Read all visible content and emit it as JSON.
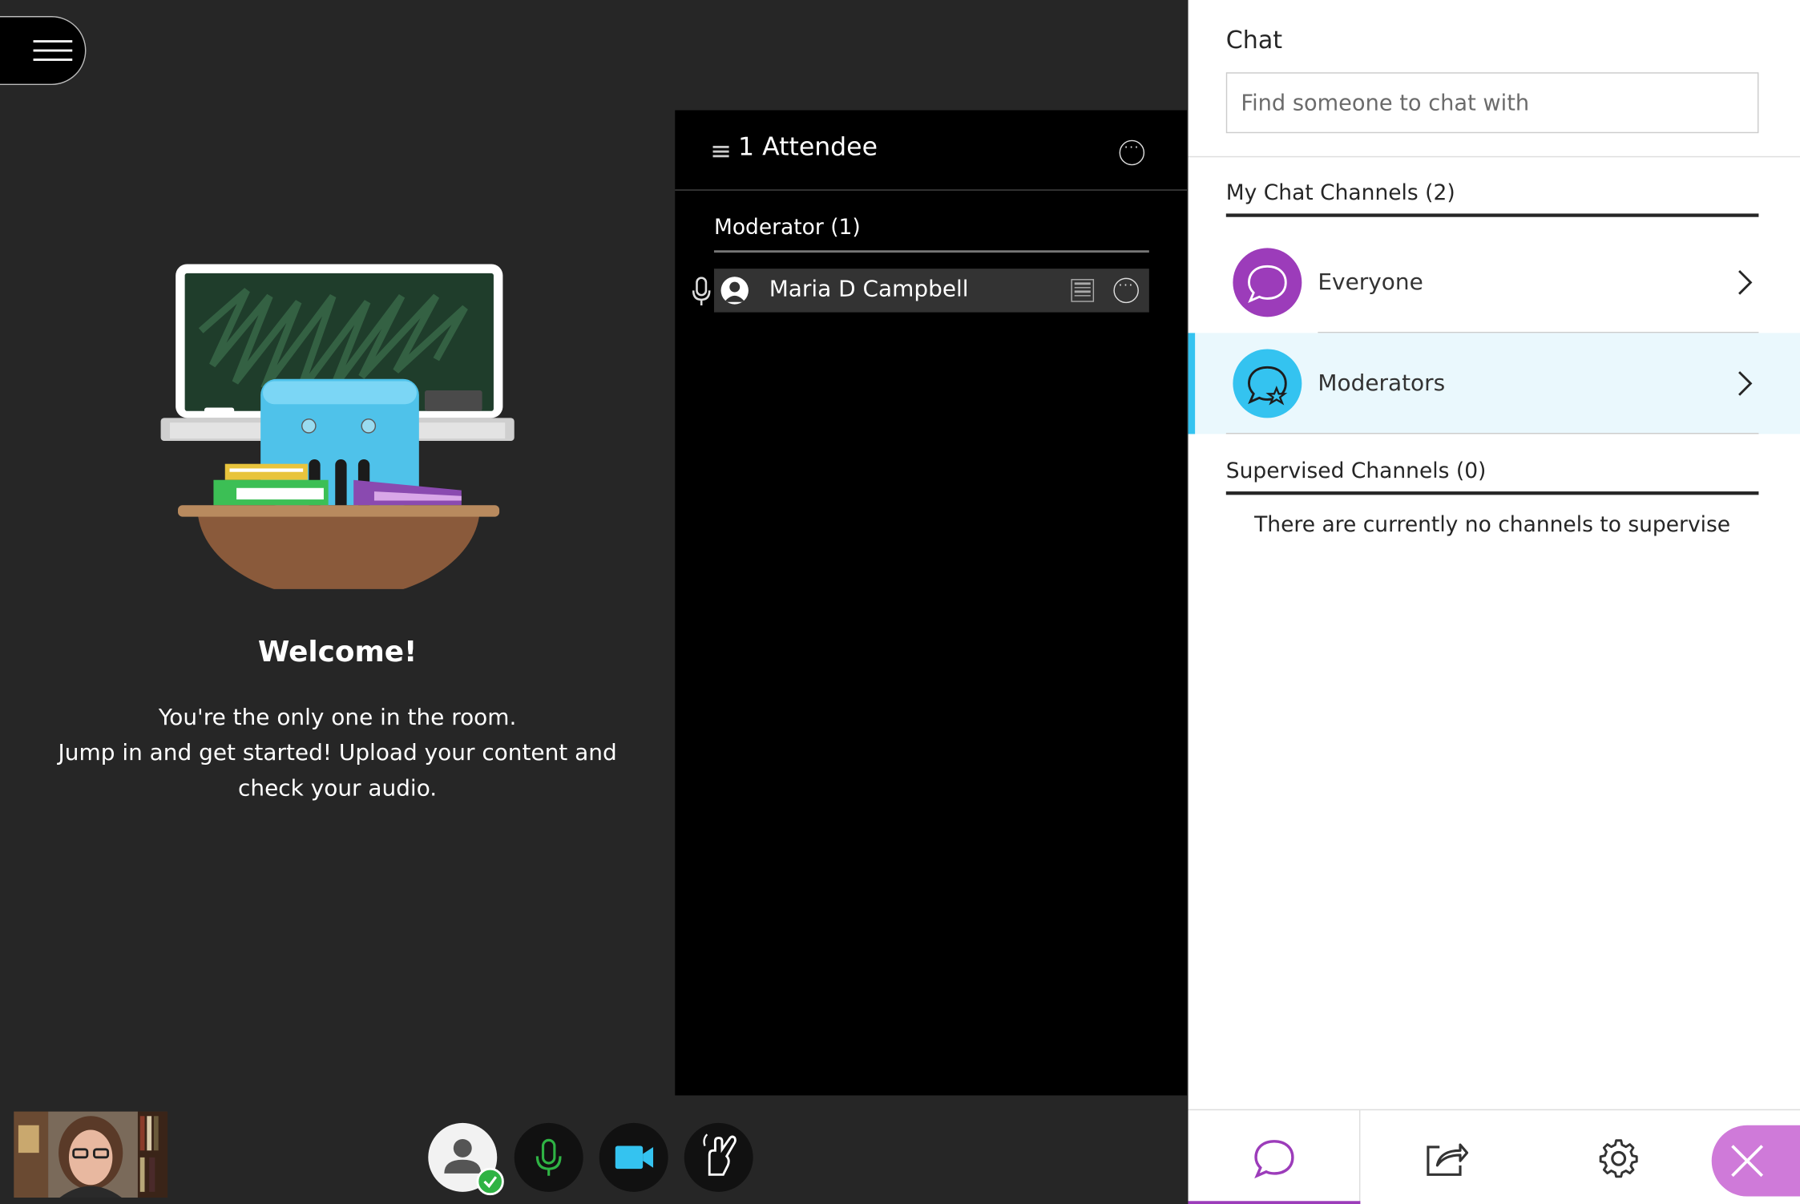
{
  "menu": {
    "icon": "hamburger-icon"
  },
  "welcome": {
    "title": "Welcome!",
    "line1": "You're the only one in the room.",
    "line2": "Jump in and get started! Upload your content and check your audio."
  },
  "attendees": {
    "title": "1 Attendee",
    "moderator_heading": "Moderator (1)",
    "list": [
      {
        "name": "Maria D Campbell",
        "role": "moderator"
      }
    ]
  },
  "chat": {
    "title": "Chat",
    "search_placeholder": "Find someone to chat with",
    "my_channels_heading": "My Chat Channels (2)",
    "channels": [
      {
        "label": "Everyone",
        "color": "#9c3cba",
        "selected": false
      },
      {
        "label": "Moderators",
        "color": "#34c3f0",
        "selected": true
      }
    ],
    "supervised_heading": "Supervised Channels (0)",
    "supervised_empty": "There are currently no channels to supervise"
  },
  "bottom_tabs": [
    "chat-icon",
    "share-content-icon",
    "settings-gear-icon",
    "close-icon"
  ],
  "toolbar": [
    "profile-icon",
    "microphone-icon",
    "camera-icon",
    "raise-hand-icon"
  ],
  "colors": {
    "accent_purple": "#9c3cba",
    "accent_blue": "#34c3f0",
    "status_green": "#2fb344"
  }
}
